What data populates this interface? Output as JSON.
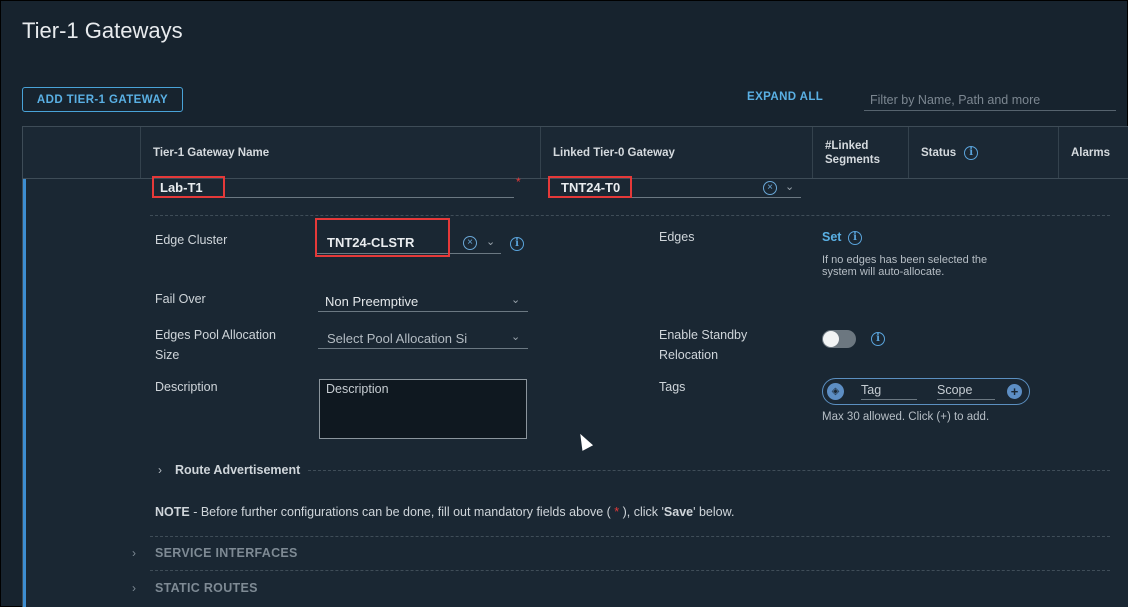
{
  "page": {
    "title": "Tier-1 Gateways"
  },
  "toolbar": {
    "add_button": "ADD TIER-1 GATEWAY",
    "expand_all": "EXPAND ALL",
    "filter_placeholder": "Filter by Name, Path and more"
  },
  "table": {
    "columns": [
      "Tier-1 Gateway Name",
      "Linked Tier-0 Gateway",
      "#Linked",
      "Segments",
      "Status",
      "Alarms"
    ]
  },
  "form": {
    "name_value": "Lab-T1",
    "required_mark": "*",
    "tier0_value": "TNT24-T0",
    "edge_cluster_label": "Edge Cluster",
    "edge_cluster_value": "TNT24-CLSTR",
    "edges_label": "Edges",
    "edges_set_link": "Set",
    "edges_help_1": "If no edges has been selected the",
    "edges_help_2": "system will auto-allocate.",
    "failover_label": "Fail Over",
    "failover_value": "Non Preemptive",
    "pool_label_1": "Edges Pool Allocation",
    "pool_label_2": "Size",
    "pool_value": "Select Pool Allocation Si",
    "standby_label_1": "Enable Standby",
    "standby_label_2": "Relocation",
    "standby_enabled": false,
    "description_label": "Description",
    "description_placeholder": "Description",
    "tags_label": "Tags",
    "tag_placeholder": "Tag",
    "scope_placeholder": "Scope",
    "tags_help": "Max 30 allowed. Click (+) to add.",
    "route_adv": "Route Advertisement",
    "note_bold": "NOTE",
    "note_text_1": " - Before further configurations can be done, fill out mandatory fields above ( ",
    "note_star": "*",
    "note_text_2": " ), click '",
    "note_save": "Save",
    "note_text_3": "' below."
  },
  "sections": {
    "service_interfaces": "SERVICE INTERFACES",
    "static_routes": "STATIC ROUTES"
  },
  "colors": {
    "accent": "#3d8dd0",
    "link": "#5ab0e4",
    "highlight_box": "#e53939",
    "background": "#17232e"
  }
}
